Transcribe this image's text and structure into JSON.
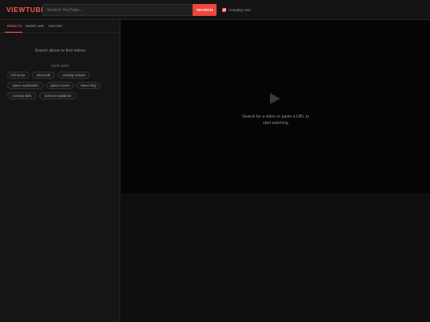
{
  "header": {
    "logo": "VIEWTUBE",
    "search_placeholder": "Search YouTube...",
    "search_button": "SEARCH",
    "autoplay_label": "Autoplay next",
    "autoplay_checked": true
  },
  "sidebar": {
    "tabs": [
      {
        "label": "RESULTS",
        "active": true
      },
      {
        "label": "SHORT URL",
        "active": false
      },
      {
        "label": "HISTORY",
        "active": false
      }
    ],
    "hint": "Search above to find videos",
    "quick_picks_title": "Quick picks",
    "chips": [
      "lofi music",
      "minecraft",
      "cooking recipes",
      "space exploration",
      "piano covers",
      "travel vlog",
      "comedy skits",
      "science explained"
    ]
  },
  "player": {
    "icon": "play-icon",
    "message_line1": "Search for a video or paste a URL to",
    "message_line2": "start watching"
  },
  "colors": {
    "accent": "#f0463c",
    "background": "#0f0f0f",
    "player_background": "#050505"
  }
}
